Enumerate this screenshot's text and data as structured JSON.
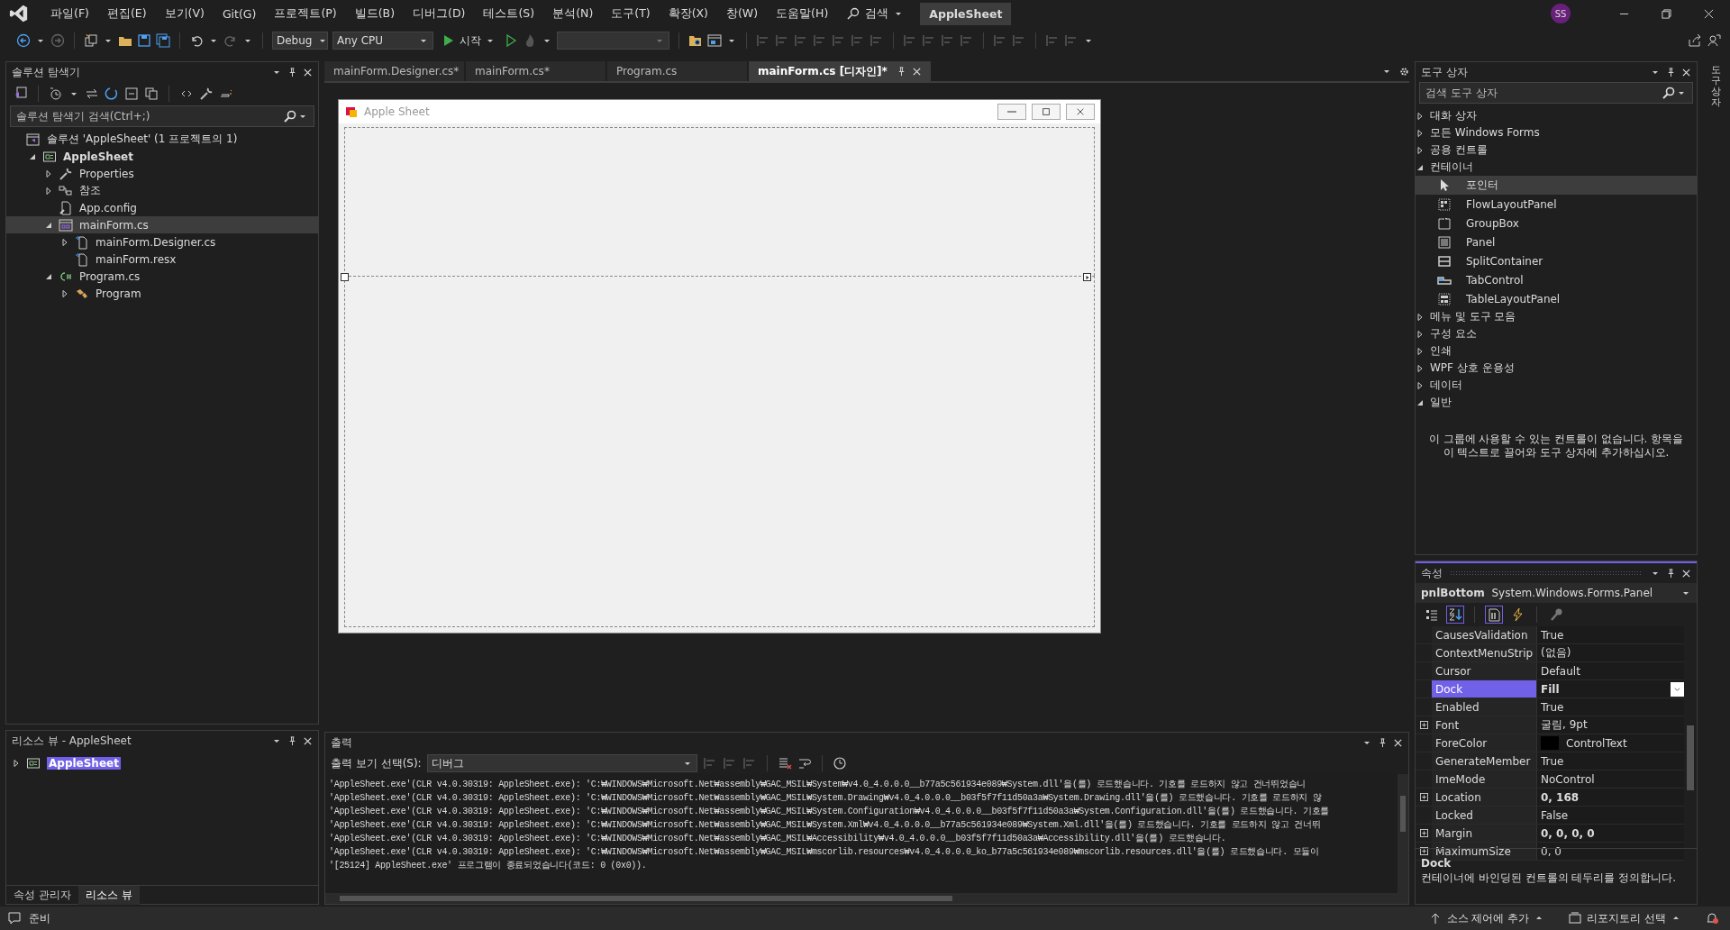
{
  "menu": {
    "items": [
      "파일(F)",
      "편집(E)",
      "보기(V)",
      "Git(G)",
      "프로젝트(P)",
      "빌드(B)",
      "디버그(D)",
      "테스트(S)",
      "분석(N)",
      "도구(T)",
      "확장(X)",
      "창(W)",
      "도움말(H)"
    ],
    "search": "검색",
    "title": "AppleSheet",
    "avatar": "SS"
  },
  "toolbar": {
    "configuration": "Debug",
    "platform": "Any CPU",
    "start": "시작"
  },
  "solution_explorer": {
    "title": "솔루션 탐색기",
    "search_placeholder": "솔루션 탐색기 검색(Ctrl+;)",
    "tree": [
      {
        "label": "솔루션 'AppleSheet'  (1 프로젝트의 1)",
        "kind": "solution",
        "selected": false,
        "children": [
          {
            "label": "AppleSheet",
            "kind": "project",
            "expanded": true,
            "selected": false,
            "children": [
              {
                "label": "Properties",
                "kind": "properties",
                "expanded": false,
                "selected": false
              },
              {
                "label": "참조",
                "kind": "references",
                "expanded": false,
                "selected": false
              },
              {
                "label": "App.config",
                "kind": "config",
                "selected": false
              },
              {
                "label": "mainForm.cs",
                "kind": "form",
                "expanded": true,
                "selected": true,
                "children": [
                  {
                    "label": "mainForm.Designer.cs",
                    "kind": "file",
                    "expanded": false,
                    "selected": false
                  },
                  {
                    "label": "mainForm.resx",
                    "kind": "file",
                    "selected": false
                  }
                ]
              },
              {
                "label": "Program.cs",
                "kind": "csharp",
                "expanded": true,
                "selected": false,
                "children": [
                  {
                    "label": "Program",
                    "kind": "class",
                    "expanded": false,
                    "selected": false
                  }
                ]
              }
            ]
          }
        ]
      }
    ]
  },
  "resource_view": {
    "title": "리소스 뷰 - AppleSheet",
    "tree": [
      {
        "label": "AppleSheet",
        "kind": "project",
        "expanded": false,
        "selected": true
      }
    ],
    "tabs": [
      {
        "label": "속성 관리자",
        "selected": false
      },
      {
        "label": "리소스 뷰",
        "selected": true
      }
    ]
  },
  "document_tabs": [
    {
      "label": "mainForm.Designer.cs*",
      "selected": false
    },
    {
      "label": "mainForm.cs*",
      "selected": false
    },
    {
      "label": "Program.cs",
      "selected": false
    },
    {
      "label": "mainForm.cs [디자인]*",
      "selected": true
    }
  ],
  "designer": {
    "form_title": "Apple Sheet",
    "panels": [
      {
        "selected": false
      },
      {
        "selected": true
      }
    ]
  },
  "output": {
    "title": "출력",
    "source_label": "출력 보기 선택(S):",
    "source": "디버그",
    "lines": [
      "'AppleSheet.exe'(CLR v4.0.30319: AppleSheet.exe): 'C:₩WINDOWS₩Microsoft.Net₩assembly₩GAC_MSIL₩System₩v4.0_4.0.0.0__b77a5c561934e089₩System.dll'을(를) 로드했습니다. 기호를 로드하지 않고 건너뛰었습니",
      "'AppleSheet.exe'(CLR v4.0.30319: AppleSheet.exe): 'C:₩WINDOWS₩Microsoft.Net₩assembly₩GAC_MSIL₩System.Drawing₩v4.0_4.0.0.0__b03f5f7f11d50a3a₩System.Drawing.dll'을(를) 로드했습니다. 기호를 로드하지 않",
      "'AppleSheet.exe'(CLR v4.0.30319: AppleSheet.exe): 'C:₩WINDOWS₩Microsoft.Net₩assembly₩GAC_MSIL₩System.Configuration₩v4.0_4.0.0.0__b03f5f7f11d50a3a₩System.Configuration.dll'을(를) 로드했습니다. 기호를",
      "'AppleSheet.exe'(CLR v4.0.30319: AppleSheet.exe): 'C:₩WINDOWS₩Microsoft.Net₩assembly₩GAC_MSIL₩System.Xml₩v4.0_4.0.0.0__b77a5c561934e089₩System.Xml.dll'을(를) 로드했습니다. 기호를 로드하지 않고 건너뛰",
      "'AppleSheet.exe'(CLR v4.0.30319: AppleSheet.exe): 'C:₩WINDOWS₩Microsoft.Net₩assembly₩GAC_MSIL₩Accessibility₩v4.0_4.0.0.0__b03f5f7f11d50a3a₩Accessibility.dll'을(를) 로드했습니다.",
      "'AppleSheet.exe'(CLR v4.0.30319: AppleSheet.exe): 'C:₩WINDOWS₩Microsoft.Net₩assembly₩GAC_MSIL₩mscorlib.resources₩v4.0_4.0.0.0_ko_b77a5c561934e089₩mscorlib.resources.dll'을(를) 로드했습니다. 모듈이",
      "'[25124] AppleSheet.exe' 프로그램이 종료되었습니다(코드: 0 (0x0))."
    ]
  },
  "toolbox": {
    "title": "도구 상자",
    "search_placeholder": "검색 도구 상자",
    "categories": [
      {
        "label": "대화 상자",
        "expanded": false
      },
      {
        "label": "모든 Windows Forms",
        "expanded": false
      },
      {
        "label": "공용 컨트롤",
        "expanded": false
      },
      {
        "label": "컨테이너",
        "expanded": true,
        "items": [
          {
            "label": "포인터",
            "kind": "pointer",
            "selected": true
          },
          {
            "label": "FlowLayoutPanel",
            "kind": "flow",
            "selected": false
          },
          {
            "label": "GroupBox",
            "kind": "groupbox",
            "selected": false
          },
          {
            "label": "Panel",
            "kind": "panel",
            "selected": false
          },
          {
            "label": "SplitContainer",
            "kind": "split",
            "selected": false
          },
          {
            "label": "TabControl",
            "kind": "tab",
            "selected": false
          },
          {
            "label": "TableLayoutPanel",
            "kind": "table",
            "selected": false
          }
        ]
      },
      {
        "label": "메뉴 및 도구 모음",
        "expanded": false
      },
      {
        "label": "구성 요소",
        "expanded": false
      },
      {
        "label": "인쇄",
        "expanded": false
      },
      {
        "label": "WPF 상호 운용성",
        "expanded": false
      },
      {
        "label": "데이터",
        "expanded": false
      },
      {
        "label": "일반",
        "expanded": true,
        "empty_note": "이 그룹에 사용할 수 있는 컨트롤이 없습니다. 항목을 이 텍스트로 끌어와 도구 상자에 추가하십시오."
      }
    ]
  },
  "side_tab": "도구 상자",
  "properties": {
    "title": "속성",
    "object_name": "pnlBottom",
    "object_type": "System.Windows.Forms.Panel",
    "view_buttons": [
      {
        "kind": "categorized",
        "selected": false
      },
      {
        "kind": "alphabetical",
        "selected": true
      },
      {
        "kind": "properties",
        "selected": true
      },
      {
        "kind": "events",
        "selected": false
      },
      {
        "kind": "pages",
        "selected": false
      }
    ],
    "rows": [
      {
        "name": "CausesValidation",
        "value": "True",
        "expandable": false,
        "bold": false,
        "selected": false
      },
      {
        "name": "ContextMenuStrip",
        "value": "(없음)",
        "expandable": false,
        "bold": false,
        "selected": false
      },
      {
        "name": "Cursor",
        "value": "Default",
        "expandable": false,
        "bold": false,
        "selected": false
      },
      {
        "name": "Dock",
        "value": "Fill",
        "expandable": false,
        "bold": true,
        "selected": true
      },
      {
        "name": "Enabled",
        "value": "True",
        "expandable": false,
        "bold": false,
        "selected": false
      },
      {
        "name": "Font",
        "value": "굴림, 9pt",
        "expandable": true,
        "bold": false,
        "selected": false
      },
      {
        "name": "ForeColor",
        "value": "ControlText",
        "expandable": false,
        "bold": false,
        "selected": false,
        "color": "#000000"
      },
      {
        "name": "GenerateMember",
        "value": "True",
        "expandable": false,
        "bold": false,
        "selected": false
      },
      {
        "name": "ImeMode",
        "value": "NoControl",
        "expandable": false,
        "bold": false,
        "selected": false
      },
      {
        "name": "Location",
        "value": "0, 168",
        "expandable": true,
        "bold": true,
        "selected": false
      },
      {
        "name": "Locked",
        "value": "False",
        "expandable": false,
        "bold": false,
        "selected": false
      },
      {
        "name": "Margin",
        "value": "0, 0, 0, 0",
        "expandable": true,
        "bold": true,
        "selected": false
      },
      {
        "name": "MaximumSize",
        "value": "0, 0",
        "expandable": true,
        "bold": false,
        "selected": false
      }
    ],
    "description_title": "Dock",
    "description": "컨테이너에 바인딩된 컨트롤의 테두리를 정의합니다."
  },
  "status_bar": {
    "text": "준비",
    "source_control": "소스 제어에 추가",
    "repository": "리포지토리 선택"
  }
}
